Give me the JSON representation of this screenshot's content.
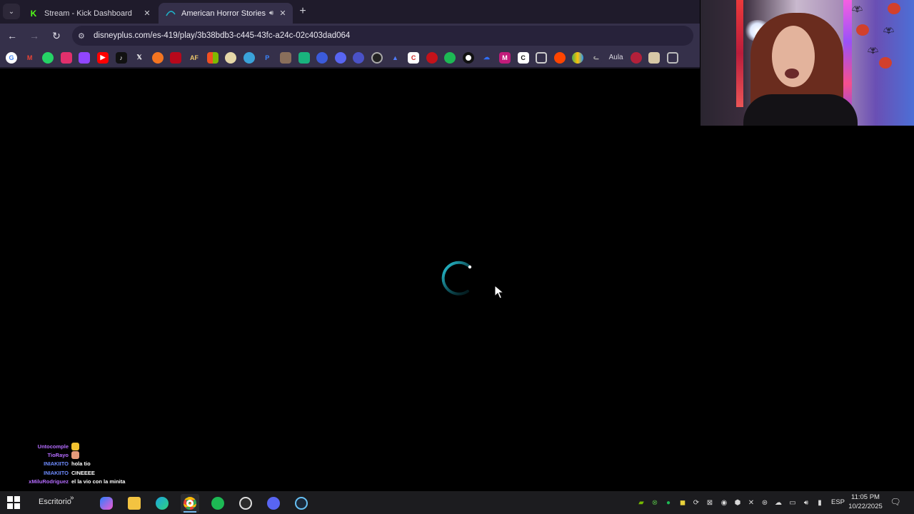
{
  "browser": {
    "tabs": [
      {
        "title": "Stream - Kick Dashboard",
        "favicon": "kick-icon",
        "active": false
      },
      {
        "title": "American Horror Stories | D",
        "favicon": "disney-plus-icon",
        "active": true,
        "audio": true
      }
    ],
    "address_bar": {
      "url": "disneyplus.com/es-419/play/3b38bdb3-c445-43fc-a24c-02c403dad064"
    },
    "bookmarks": {
      "text_item": "Aula",
      "icons": [
        "google-icon",
        "gmail-icon",
        "whatsapp-icon",
        "instagram-icon",
        "twitch-icon",
        "youtube-icon",
        "tiktok-icon",
        "x-icon",
        "crunchyroll-icon",
        "pinterest-icon",
        "affinity-icon",
        "microsoft-icon",
        "pill-icon",
        "bubble-icon",
        "paypal-icon",
        "photo-icon",
        "calendar-icon",
        "app-icon",
        "discord-icon",
        "discord-alt-icon",
        "circle-icon",
        "drop-icon",
        "canva-icon",
        "red-icon",
        "spotify-icon",
        "dot-icon",
        "cloud-icon",
        "m-icon",
        "c-icon",
        "qr-icon",
        "reddit-icon",
        "colorful-icon",
        "cat-icon",
        "mask-icon",
        "face-icon",
        "ai-icon"
      ]
    }
  },
  "player": {
    "state": "loading",
    "spinner_color": "#1fb3c9"
  },
  "chat": [
    {
      "user": "Untocomple",
      "message": "",
      "user_color": "#b56cff",
      "emote": "crown-emote"
    },
    {
      "user": "TioRayo",
      "message": "",
      "user_color": "#b56cff",
      "emote": "face-emote"
    },
    {
      "user": "INIAKIITO",
      "message": "hola tio",
      "user_color": "#6f8cff"
    },
    {
      "user": "INIAKIITO",
      "message": "CINEEEE",
      "user_color": "#6f8cff"
    },
    {
      "user": "xMiluRodriguez",
      "message": "el la vio con la minita",
      "user_color": "#b56cff"
    }
  ],
  "taskbar": {
    "desktop_label": "Escritorio",
    "language": "ESP",
    "time": "11:05 PM",
    "date": "10/22/2025",
    "apps": [
      "copilot-icon",
      "file-explorer-icon",
      "edge-icon",
      "chrome-icon",
      "spotify-icon",
      "obs-icon",
      "discord-icon",
      "steam-icon"
    ]
  }
}
